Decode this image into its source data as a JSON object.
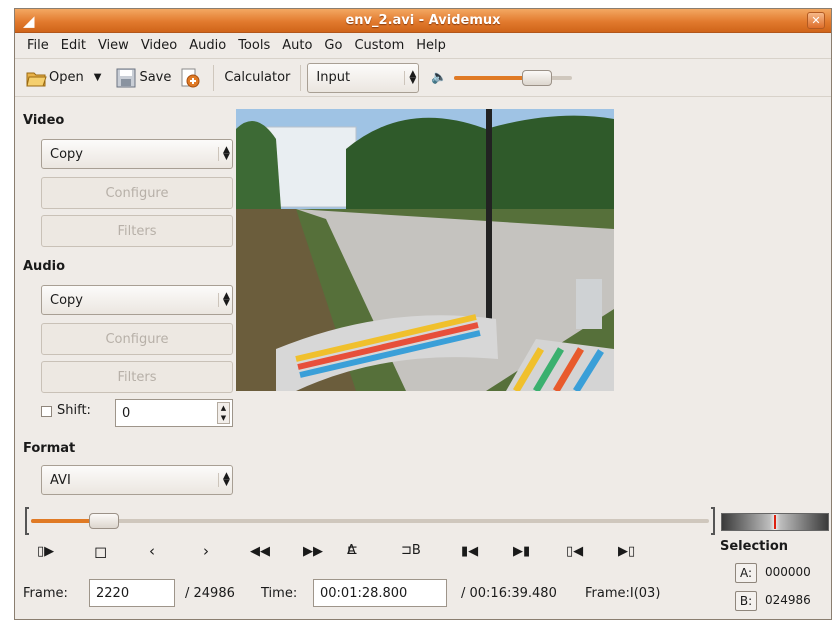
{
  "window": {
    "title": "env_2.avi - Avidemux"
  },
  "menu": [
    "File",
    "Edit",
    "View",
    "Video",
    "Audio",
    "Tools",
    "Auto",
    "Go",
    "Custom",
    "Help"
  ],
  "toolbar": {
    "open": "Open",
    "save": "Save",
    "calculator": "Calculator",
    "display_mode": "Input",
    "volume_level": 0.78
  },
  "video": {
    "heading": "Video",
    "codec": "Copy",
    "configure": "Configure",
    "filters": "Filters"
  },
  "audio": {
    "heading": "Audio",
    "codec": "Copy",
    "configure": "Configure",
    "filters": "Filters"
  },
  "shift": {
    "label": "Shift:",
    "value": "0",
    "checked": false
  },
  "format": {
    "heading": "Format",
    "container": "AVI"
  },
  "seek": {
    "position": 0.089
  },
  "transport": {
    "mark_a": "A",
    "mark_b": "B"
  },
  "status": {
    "frame_label": "Frame:",
    "frame": "2220",
    "frame_total": "/ 24986",
    "time_label": "Time:",
    "time": "00:01:28.800",
    "time_total": "/ 00:16:39.480",
    "frame_type": "Frame:I(03)"
  },
  "selection": {
    "heading": "Selection",
    "a_label": "A:",
    "a_value": "000000",
    "b_label": "B:",
    "b_value": "024986"
  }
}
